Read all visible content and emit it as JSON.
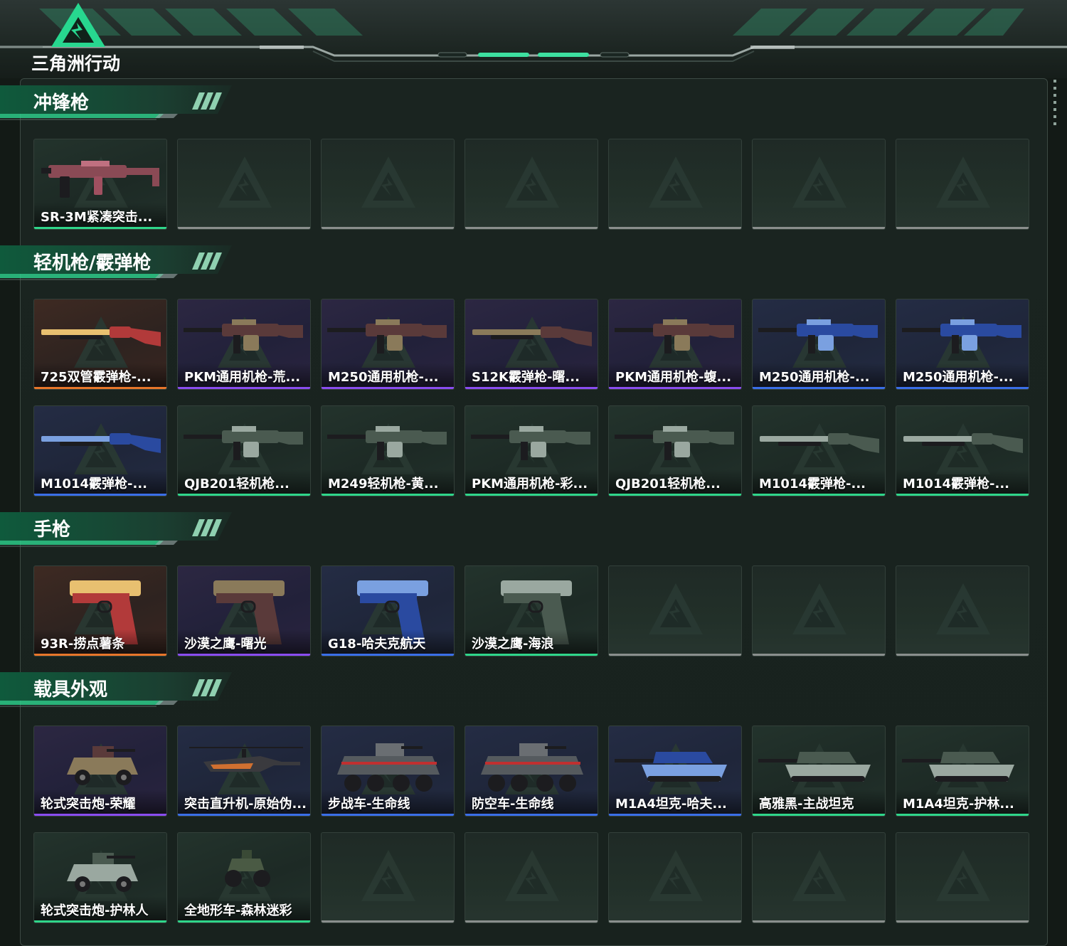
{
  "app": {
    "title": "三角洲行动"
  },
  "colors": {
    "accent": "#3de0a0",
    "rarity_orange": "#e8762a",
    "rarity_purple": "#8a4cf0",
    "rarity_blue": "#3a6ee8",
    "rarity_green": "#2fd68a",
    "empty_strip": "#8a8f8d"
  },
  "sections": [
    {
      "title": "冲锋枪",
      "items": [
        {
          "name": "SR-3M紧凑突击...",
          "rarity": "green",
          "icon": "smg-icon"
        }
      ]
    },
    {
      "title": "轻机枪/霰弹枪",
      "items": [
        {
          "name": "725双管霰弹枪-...",
          "rarity": "orange",
          "icon": "shotgun-icon"
        },
        {
          "name": "PKM通用机枪-荒...",
          "rarity": "purple",
          "icon": "machine-gun-icon"
        },
        {
          "name": "M250通用机枪-...",
          "rarity": "purple",
          "icon": "machine-gun-icon"
        },
        {
          "name": "S12K霰弹枪-曙...",
          "rarity": "purple",
          "icon": "shotgun-icon"
        },
        {
          "name": "PKM通用机枪-蝮...",
          "rarity": "purple",
          "icon": "machine-gun-icon"
        },
        {
          "name": "M250通用机枪-...",
          "rarity": "blue",
          "icon": "machine-gun-icon"
        },
        {
          "name": "M250通用机枪-...",
          "rarity": "blue",
          "icon": "machine-gun-icon"
        },
        {
          "name": "M1014霰弹枪-...",
          "rarity": "blue",
          "icon": "shotgun-icon"
        },
        {
          "name": "QJB201轻机枪...",
          "rarity": "green",
          "icon": "machine-gun-icon"
        },
        {
          "name": "M249轻机枪-黄...",
          "rarity": "green",
          "icon": "machine-gun-icon"
        },
        {
          "name": "PKM通用机枪-彩...",
          "rarity": "green",
          "icon": "machine-gun-icon"
        },
        {
          "name": "QJB201轻机枪...",
          "rarity": "green",
          "icon": "machine-gun-icon"
        },
        {
          "name": "M1014霰弹枪-...",
          "rarity": "green",
          "icon": "shotgun-icon"
        },
        {
          "name": "M1014霰弹枪-...",
          "rarity": "green",
          "icon": "shotgun-icon"
        }
      ]
    },
    {
      "title": "手枪",
      "items": [
        {
          "name": "93R-捞点薯条",
          "rarity": "orange",
          "icon": "pistol-icon"
        },
        {
          "name": "沙漠之鹰-曙光",
          "rarity": "purple",
          "icon": "pistol-icon"
        },
        {
          "name": "G18-哈夫克航天",
          "rarity": "blue",
          "icon": "pistol-icon"
        },
        {
          "name": "沙漠之鹰-海浪",
          "rarity": "green",
          "icon": "pistol-icon"
        }
      ]
    },
    {
      "title": "载具外观",
      "items": [
        {
          "name": "轮式突击炮-荣耀",
          "rarity": "purple",
          "icon": "armored-car-icon"
        },
        {
          "name": "突击直升机-原始伪...",
          "rarity": "blue",
          "icon": "helicopter-icon"
        },
        {
          "name": "步战车-生命线",
          "rarity": "blue",
          "icon": "ifv-icon"
        },
        {
          "name": "防空车-生命线",
          "rarity": "blue",
          "icon": "ifv-icon"
        },
        {
          "name": "M1A4坦克-哈夫...",
          "rarity": "blue",
          "icon": "tank-icon"
        },
        {
          "name": "高雅黑-主战坦克",
          "rarity": "green",
          "icon": "tank-icon"
        },
        {
          "name": "M1A4坦克-护林...",
          "rarity": "green",
          "icon": "tank-icon"
        },
        {
          "name": "轮式突击炮-护林人",
          "rarity": "green",
          "icon": "armored-car-icon"
        },
        {
          "name": "全地形车-森林迷彩",
          "rarity": "green",
          "icon": "atv-icon"
        }
      ]
    }
  ]
}
